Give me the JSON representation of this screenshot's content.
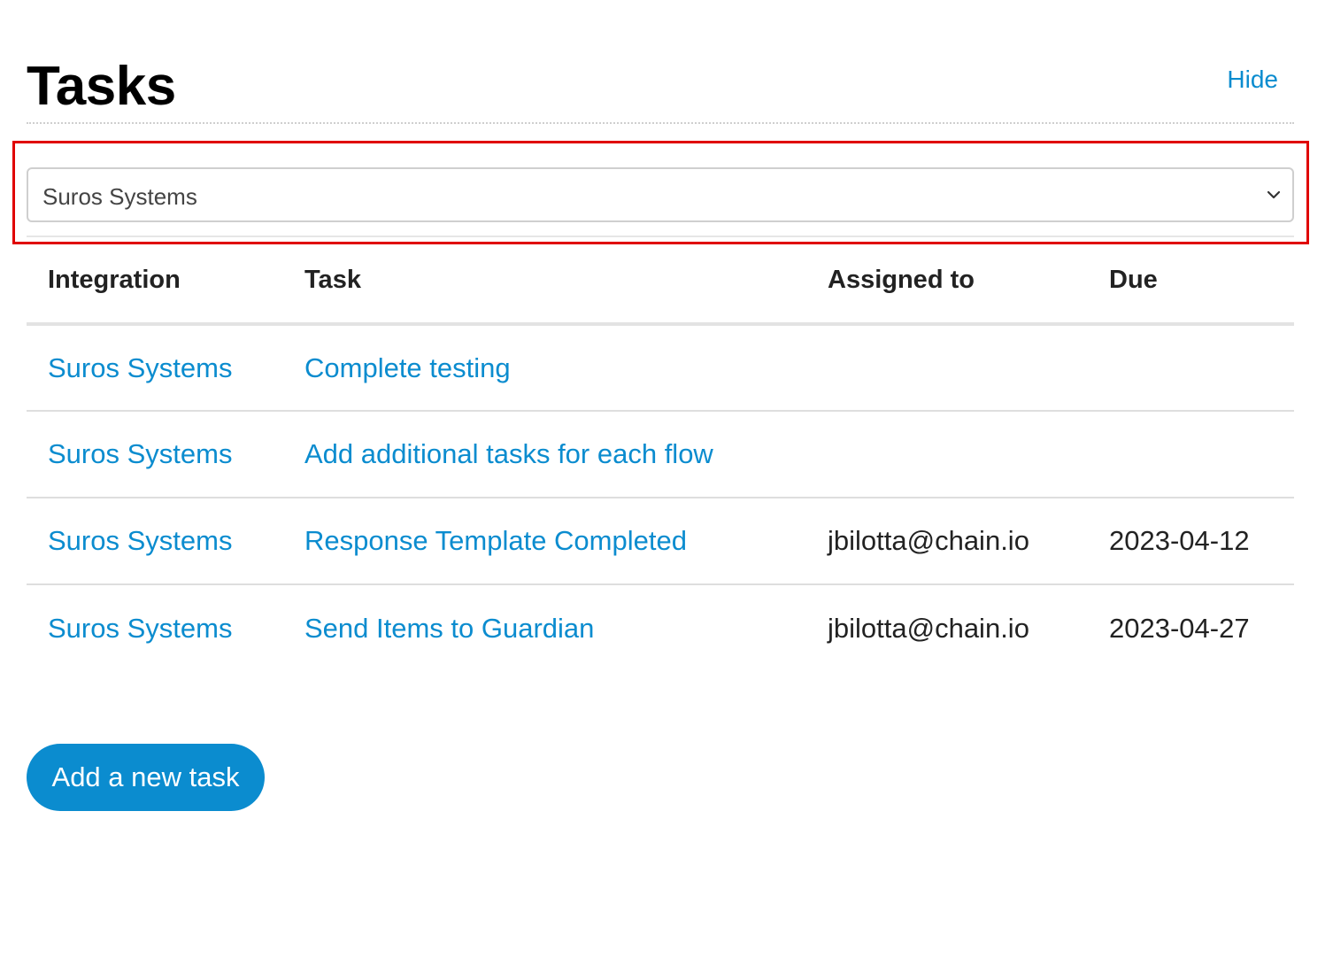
{
  "header": {
    "title": "Tasks",
    "hide_label": "Hide"
  },
  "filter": {
    "selected": "Suros Systems"
  },
  "table": {
    "columns": [
      "Integration",
      "Task",
      "Assigned to",
      "Due"
    ],
    "rows": [
      {
        "integration": "Suros Systems",
        "task": "Complete testing",
        "assigned_to": "",
        "due": ""
      },
      {
        "integration": "Suros Systems",
        "task": "Add additional tasks for each flow",
        "assigned_to": "",
        "due": ""
      },
      {
        "integration": "Suros Systems",
        "task": "Response Template Completed",
        "assigned_to": "jbilotta@chain.io",
        "due": "2023-04-12"
      },
      {
        "integration": "Suros Systems",
        "task": "Send Items to Guardian",
        "assigned_to": "jbilotta@chain.io",
        "due": "2023-04-27"
      }
    ]
  },
  "actions": {
    "add_task_label": "Add a new task"
  },
  "colors": {
    "accent": "#0b8ccf",
    "highlight": "#e00000"
  }
}
